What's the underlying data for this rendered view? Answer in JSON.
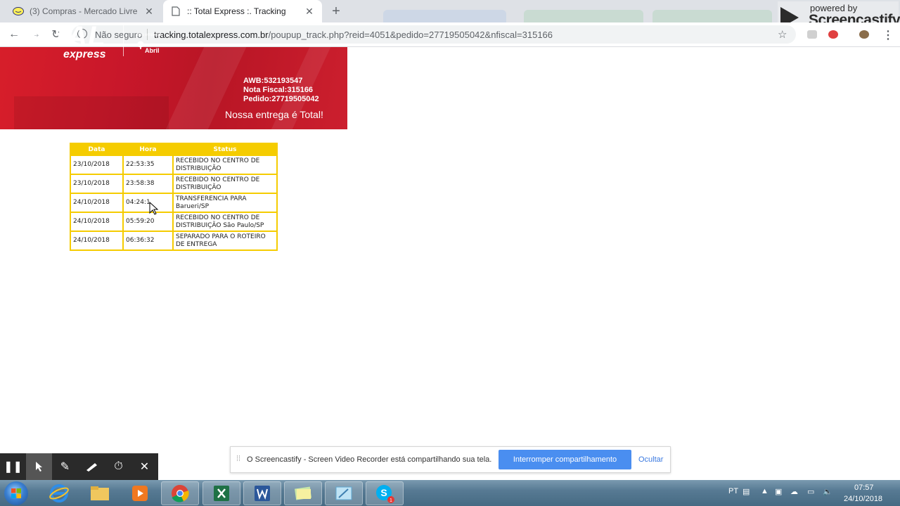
{
  "browser": {
    "tabs": [
      {
        "title": "(3) Compras - Mercado Livre",
        "active": false
      },
      {
        "title": ":: Total Express :. Tracking",
        "active": true
      }
    ],
    "security_label": "Não seguro",
    "url_host": "tracking.totalexpress.com.br",
    "url_path": "/poupup_track.php?reid=4051&pedido=27719505042&nfiscal=315166"
  },
  "watermark": {
    "powered_by": "powered by",
    "brand": "Screencastify"
  },
  "banner": {
    "logo_main": "TOTAL",
    "logo_sub": "express",
    "parent_caption": "uma empresa",
    "parent_name": "Abril",
    "awb": "AWB:532193547",
    "nota_fiscal": "Nota Fiscal:315166",
    "pedido": "Pedido:27719505042",
    "slogan": "Nossa entrega é Total!"
  },
  "tracking": {
    "headers": [
      "Data",
      "Hora",
      "Status"
    ],
    "rows": [
      {
        "data": "23/10/2018",
        "hora": "22:53:35",
        "status": "RECEBIDO NO CENTRO DE DISTRIBUIÇÃO"
      },
      {
        "data": "23/10/2018",
        "hora": "23:58:38",
        "status": "RECEBIDO NO CENTRO DE DISTRIBUIÇÃO"
      },
      {
        "data": "24/10/2018",
        "hora": "04:24:1",
        "status": "TRANSFERENCIA PARA Barueri/SP"
      },
      {
        "data": "24/10/2018",
        "hora": "05:59:20",
        "status": "RECEBIDO NO CENTRO DE DISTRIBUIÇÃO São Paulo/SP"
      },
      {
        "data": "24/10/2018",
        "hora": "06:36:32",
        "status": "SEPARADO PARA O ROTEIRO DE ENTREGA"
      }
    ]
  },
  "share_bar": {
    "message": "O Screencastify - Screen Video Recorder está compartilhando sua tela.",
    "stop_label": "Interromper compartilhamento",
    "hide_label": "Ocultar"
  },
  "taskbar": {
    "language": "PT",
    "time": "07:57",
    "date": "24/10/2018"
  },
  "colors": {
    "banner_red": "#c8172a",
    "table_yellow": "#f5cc00",
    "share_button": "#4a8ef0"
  }
}
